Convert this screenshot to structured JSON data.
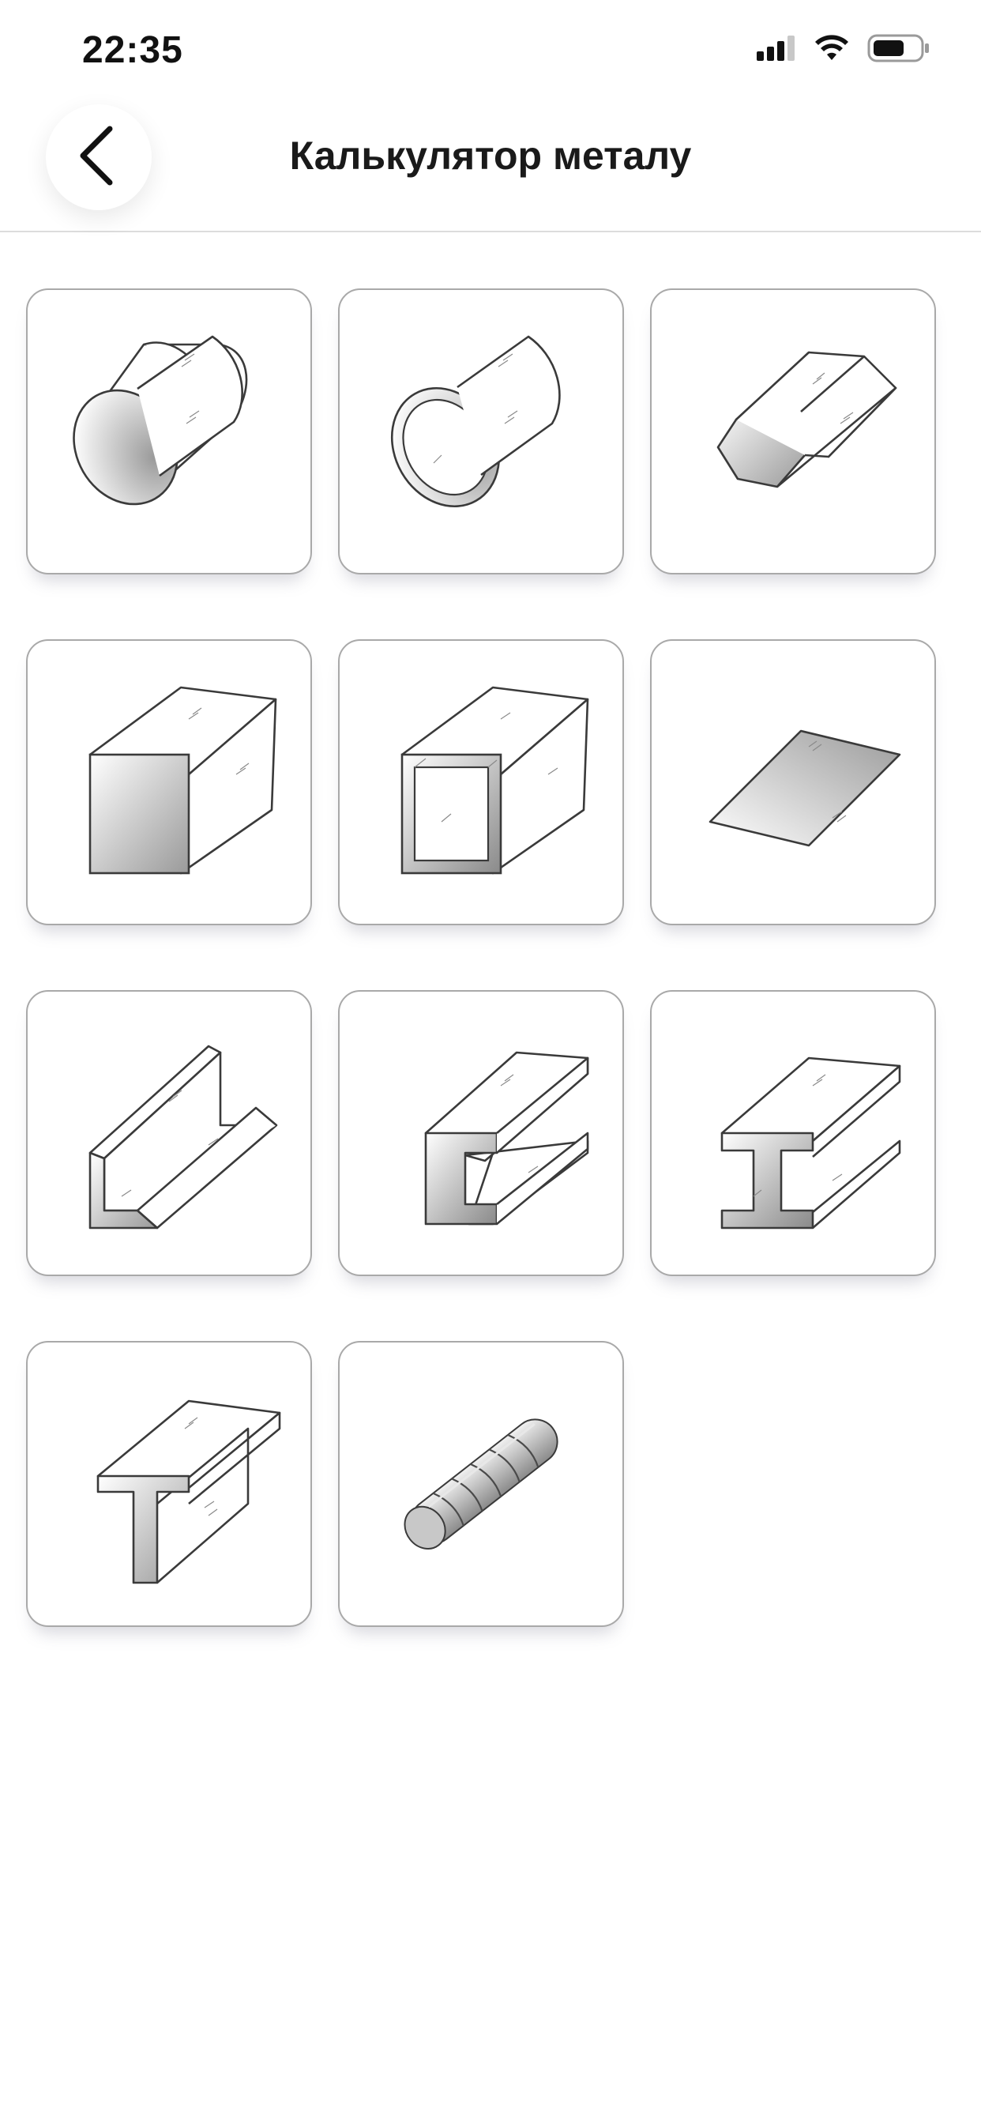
{
  "status_bar": {
    "time": "22:35",
    "icons": [
      "cellular-signal-icon",
      "wifi-icon",
      "battery-icon"
    ]
  },
  "header": {
    "back_icon": "chevron-left-icon",
    "title": "Калькулятор металу"
  },
  "profiles": [
    {
      "icon": "round-bar-icon"
    },
    {
      "icon": "round-pipe-icon"
    },
    {
      "icon": "hexagon-bar-icon"
    },
    {
      "icon": "square-bar-icon"
    },
    {
      "icon": "square-pipe-icon"
    },
    {
      "icon": "sheet-icon"
    },
    {
      "icon": "angle-icon"
    },
    {
      "icon": "channel-icon"
    },
    {
      "icon": "i-beam-icon"
    },
    {
      "icon": "t-bar-icon"
    },
    {
      "icon": "rebar-icon"
    }
  ],
  "colors": {
    "tile_border": "#a9a9a9",
    "divider": "#dcdcdc",
    "background": "#ffffff"
  }
}
